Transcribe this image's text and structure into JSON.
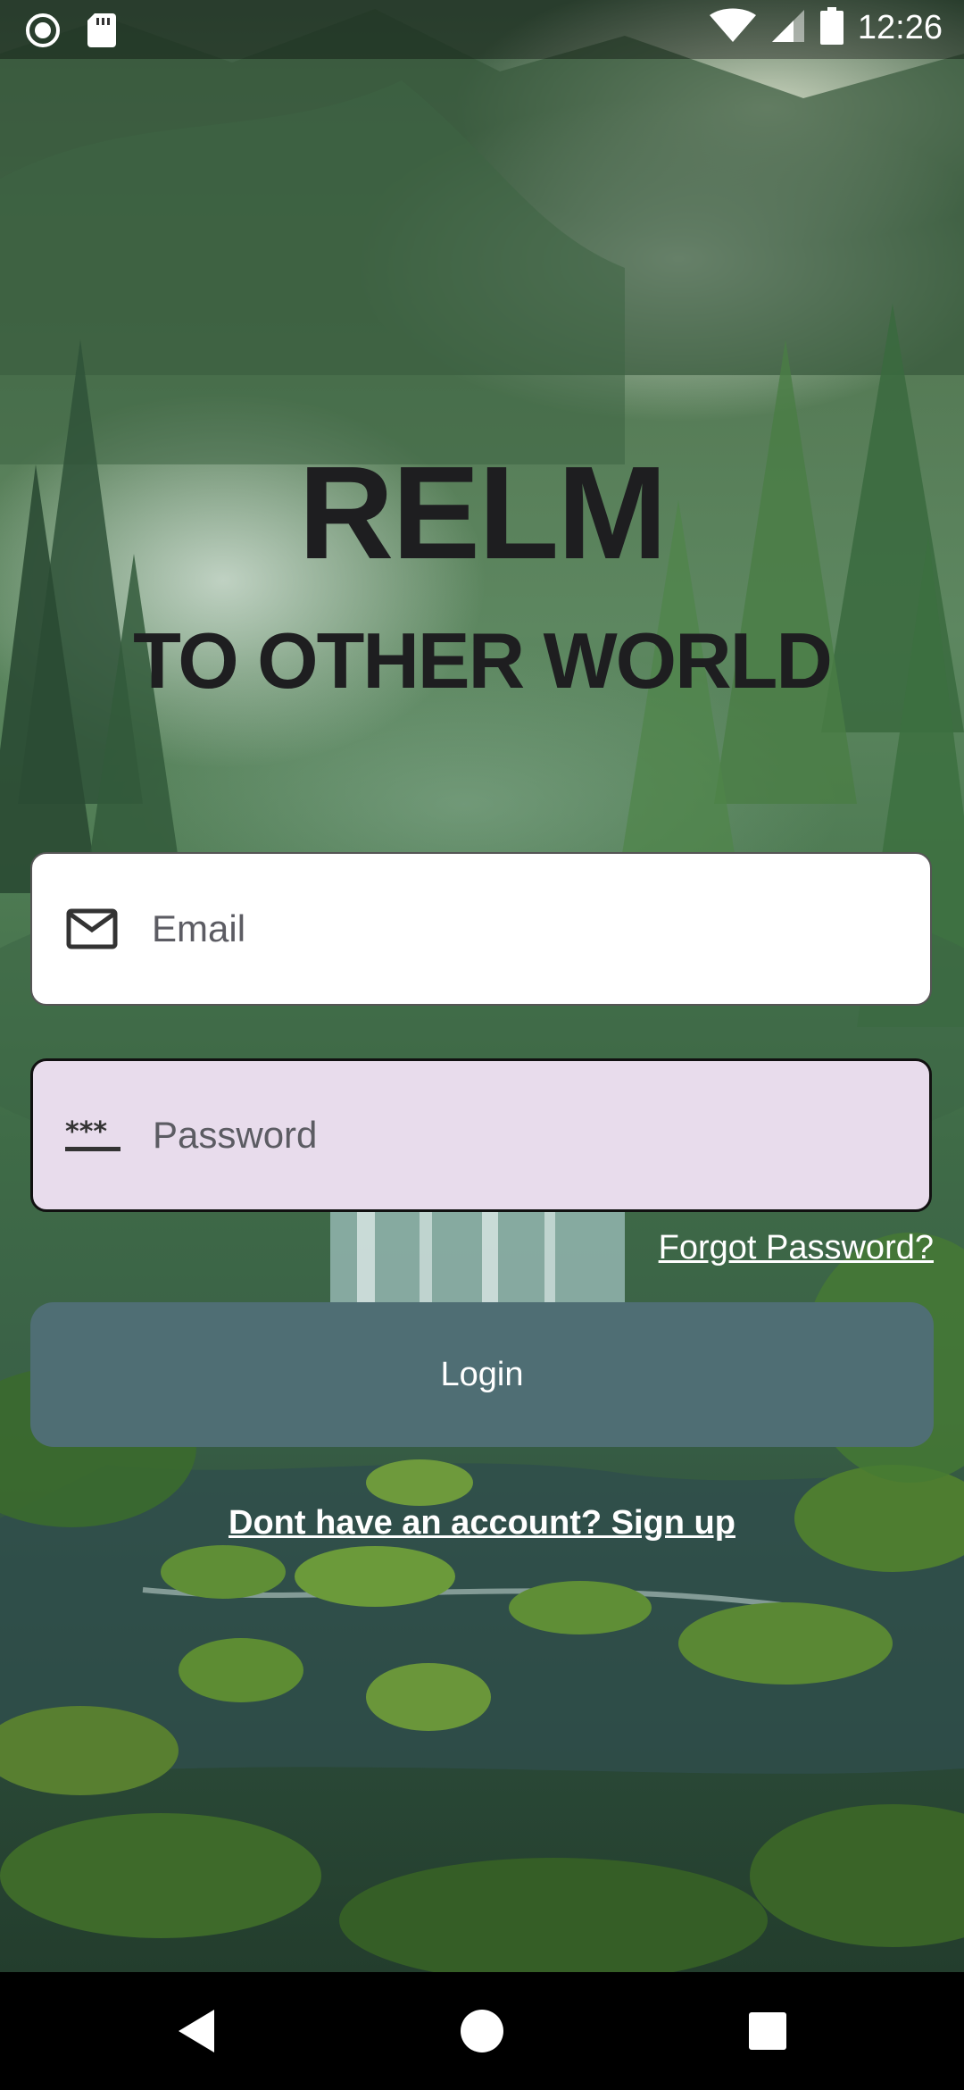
{
  "status_bar": {
    "time": "12:26",
    "icons": [
      "record-icon",
      "sd-card-icon",
      "wifi-icon",
      "signal-icon",
      "battery-icon"
    ]
  },
  "app": {
    "title": "RELM",
    "subtitle": "TO OTHER WORLD"
  },
  "form": {
    "email": {
      "icon": "mail-icon",
      "placeholder": "Email",
      "value": ""
    },
    "password": {
      "icon": "password-icon",
      "placeholder": "Password",
      "value": ""
    },
    "forgot_label": "Forgot Password?",
    "login_label": "Login",
    "signup_label": "Dont have an account? Sign up"
  },
  "nav_bar": {
    "icons": [
      "back-icon",
      "home-icon",
      "recents-icon"
    ]
  },
  "colors": {
    "login_button": "#4f6e74",
    "password_field_bg": "#e8dcec",
    "title_text": "#1e1e20"
  }
}
